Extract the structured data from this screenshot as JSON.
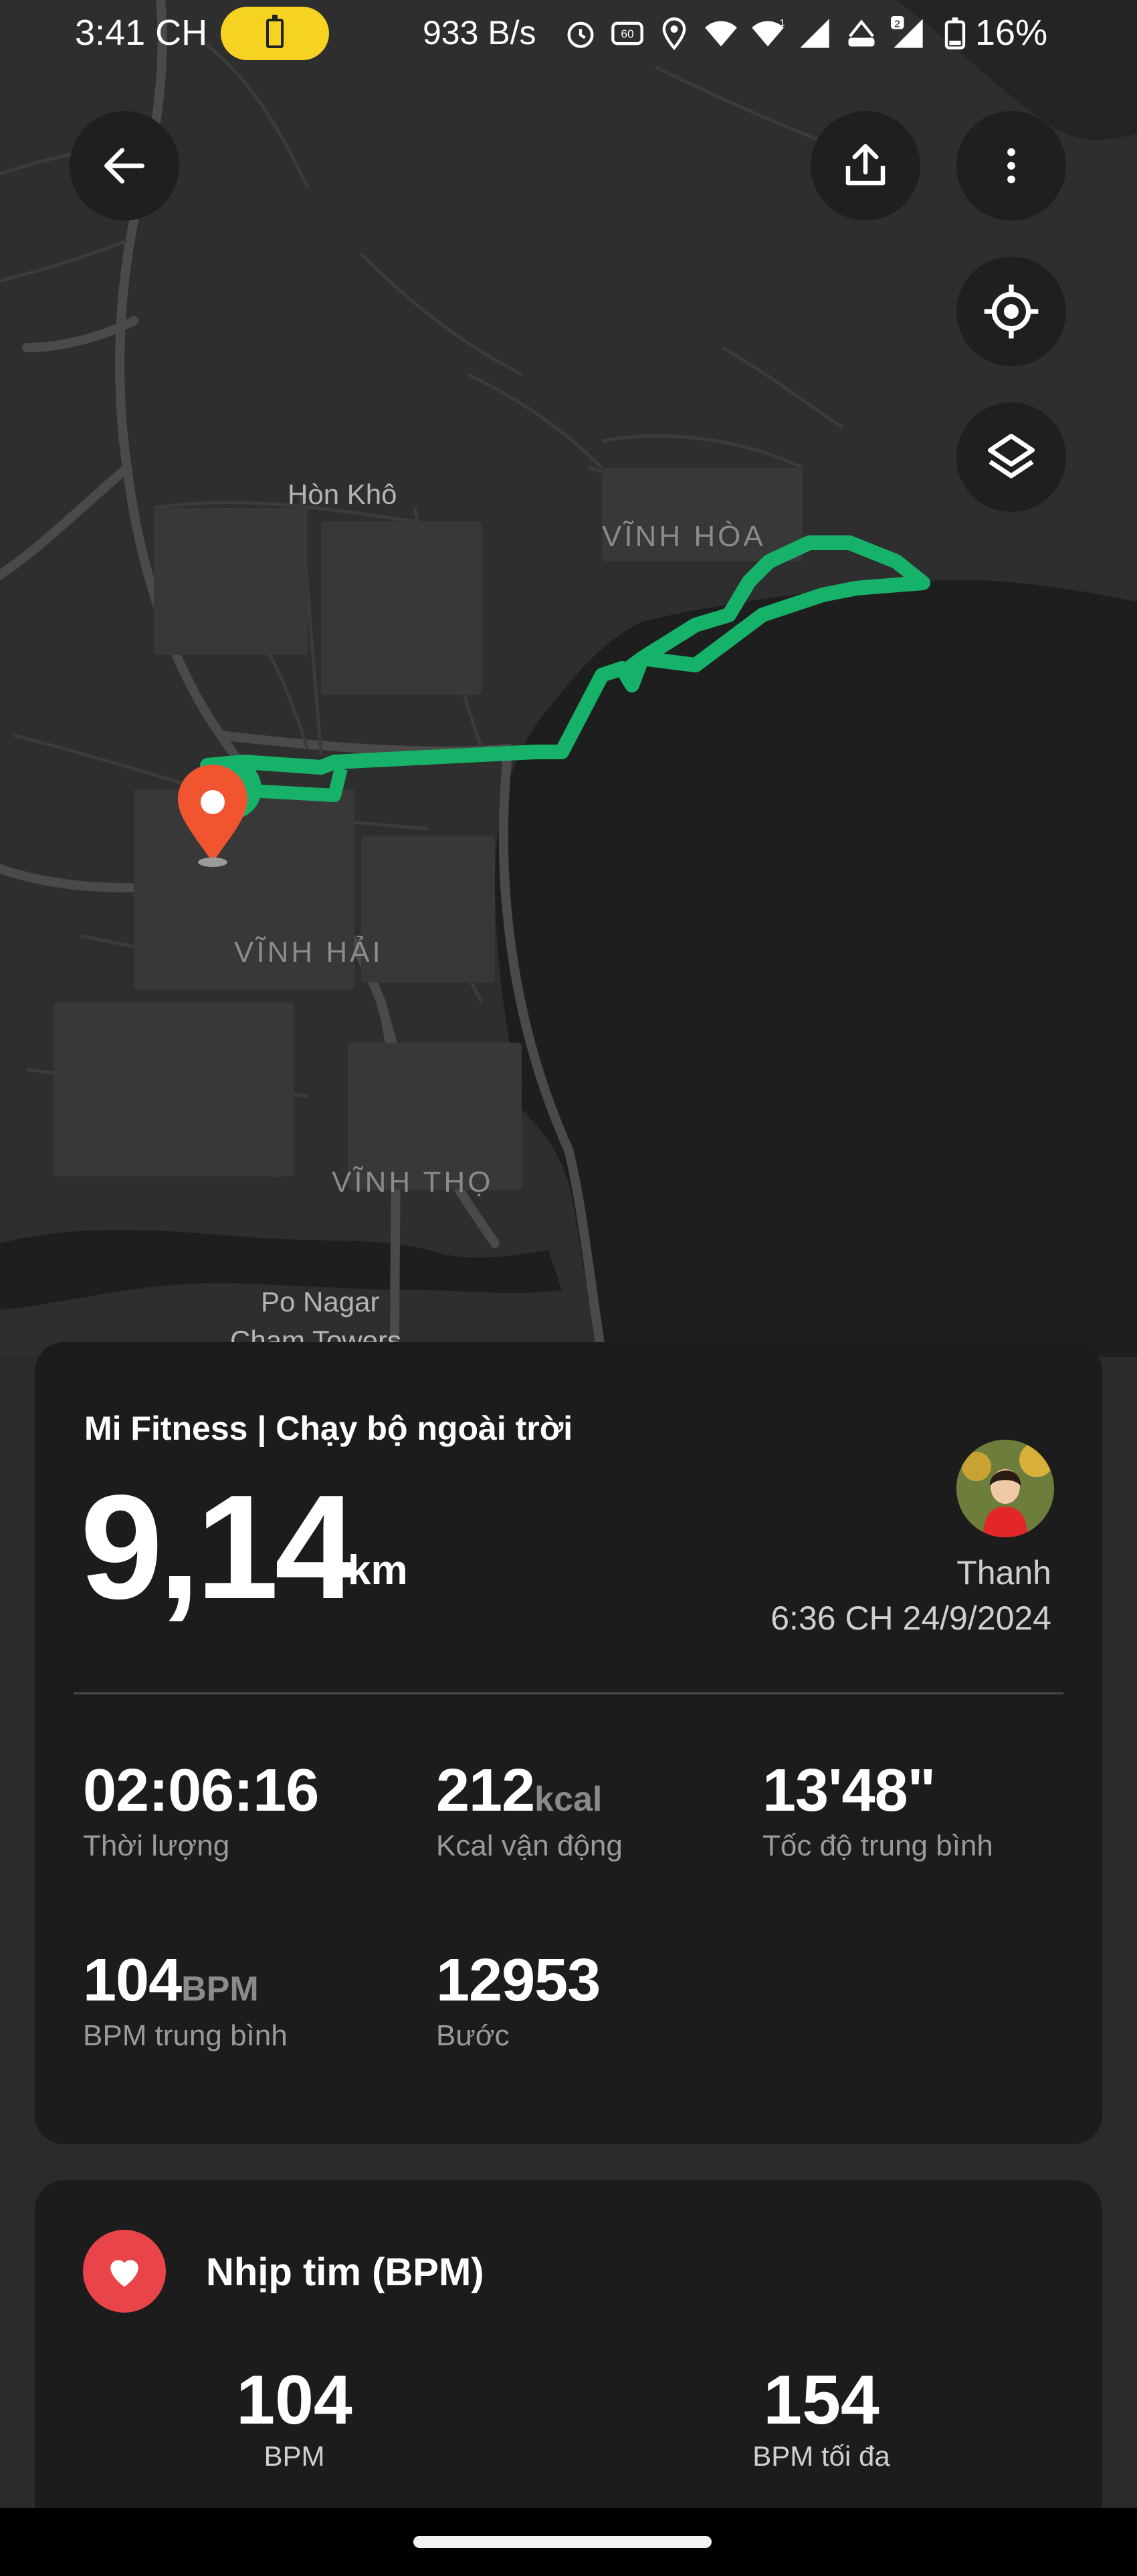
{
  "status_bar": {
    "time": "3:41 CH",
    "net_speed": "933 B/s",
    "battery_pct": "16%",
    "icons": [
      "alarm-icon",
      "refresh-60hz-icon",
      "location-icon",
      "wifi-icon",
      "signal-1-icon",
      "volte-icon",
      "signal-2-icon",
      "battery-icon"
    ],
    "sim1_label": "1",
    "sim2_label": "2",
    "refresh_label": "60",
    "volte_label": "VoLTE"
  },
  "map": {
    "labels": {
      "hon_kho": "Hòn Khô",
      "vinh_hoa": "VĨNH HÒA",
      "vinh_hai": "VĨNH HẢI",
      "vinh_tho": "VĨNH THỌ",
      "po_nagar": "Po Nagar",
      "cham_towers": "Cham Towers"
    },
    "route_color": "#17b26a",
    "marker_color": "#f0552f",
    "buttons": {
      "back": "back-arrow-icon",
      "share": "share-icon",
      "more": "more-vertical-icon",
      "locate": "locate-icon",
      "layers": "layers-icon"
    }
  },
  "summary": {
    "app_title": "Mi Fitness | Chạy bộ ngoài trời",
    "distance": "9,14",
    "distance_unit": "km",
    "user_name": "Thanh",
    "date": "6:36 CH 24/9/2024",
    "stats": [
      {
        "value": "02:06:16",
        "unit": "",
        "label": "Thời lượng"
      },
      {
        "value": "212",
        "unit": "kcal",
        "label": "Kcal vận động"
      },
      {
        "value": "13'48\"",
        "unit": "",
        "label": "Tốc độ trung bình"
      },
      {
        "value": "104",
        "unit": "BPM",
        "label": "BPM trung bình"
      },
      {
        "value": "12953",
        "unit": "",
        "label": "Bước"
      }
    ]
  },
  "heart": {
    "title": "Nhịp tim (BPM)",
    "avg_value": "104",
    "avg_label": "BPM",
    "max_value": "154",
    "max_label": "BPM tối đa",
    "accent": "#e9444a"
  }
}
